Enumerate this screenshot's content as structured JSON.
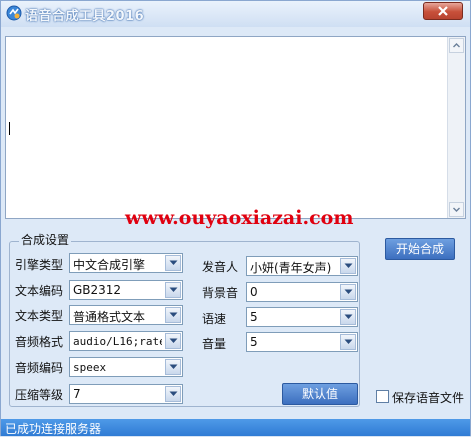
{
  "window": {
    "title": "语音合成工具2016"
  },
  "watermark": "www.ouyaoxiazai.com",
  "settings": {
    "group_title": "合成设置",
    "engine": {
      "label": "引擎类型",
      "value": "中文合成引擎"
    },
    "encoding": {
      "label": "文本编码",
      "value": "GB2312"
    },
    "text_type": {
      "label": "文本类型",
      "value": "普通格式文本"
    },
    "audio_format": {
      "label": "音频格式",
      "value": "audio/L16;rate="
    },
    "audio_codec": {
      "label": "音频编码",
      "value": "speex"
    },
    "compression": {
      "label": "压缩等级",
      "value": "7"
    },
    "speaker": {
      "label": "发音人",
      "value": "小妍(青年女声)"
    },
    "bg_sound": {
      "label": "背景音",
      "value": "0"
    },
    "speed": {
      "label": "语速",
      "value": "5"
    },
    "volume": {
      "label": "音量",
      "value": "5"
    },
    "default_button": "默认值"
  },
  "start_button": "开始合成",
  "save_audio": {
    "label": "保存语音文件",
    "checked": false
  },
  "status": "已成功连接服务器",
  "colors": {
    "accent": "#3c6fbf",
    "status_bar": "#2f7bd4",
    "watermark": "#e0000f",
    "close": "#c7503a"
  }
}
